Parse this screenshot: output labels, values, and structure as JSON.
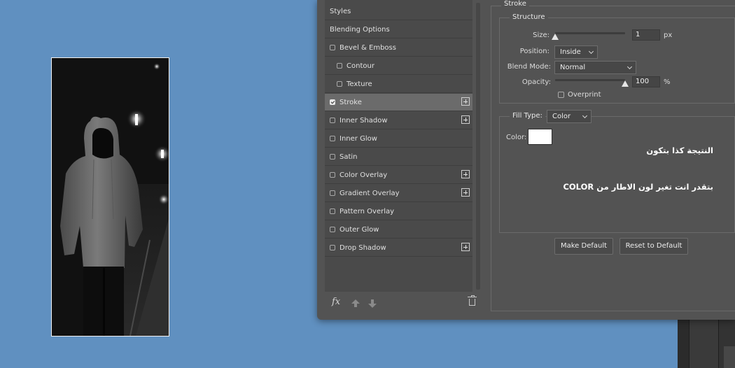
{
  "styles_list": [
    {
      "label": "Styles",
      "has_checkbox": false,
      "checked": false,
      "sub": false,
      "has_plus": false,
      "selected": false
    },
    {
      "label": "Blending Options",
      "has_checkbox": false,
      "checked": false,
      "sub": false,
      "has_plus": false,
      "selected": false
    },
    {
      "label": "Bevel & Emboss",
      "has_checkbox": true,
      "checked": false,
      "sub": false,
      "has_plus": false,
      "selected": false
    },
    {
      "label": "Contour",
      "has_checkbox": true,
      "checked": false,
      "sub": true,
      "has_plus": false,
      "selected": false
    },
    {
      "label": "Texture",
      "has_checkbox": true,
      "checked": false,
      "sub": true,
      "has_plus": false,
      "selected": false
    },
    {
      "label": "Stroke",
      "has_checkbox": true,
      "checked": true,
      "sub": false,
      "has_plus": true,
      "selected": true
    },
    {
      "label": "Inner Shadow",
      "has_checkbox": true,
      "checked": false,
      "sub": false,
      "has_plus": true,
      "selected": false
    },
    {
      "label": "Inner Glow",
      "has_checkbox": true,
      "checked": false,
      "sub": false,
      "has_plus": false,
      "selected": false
    },
    {
      "label": "Satin",
      "has_checkbox": true,
      "checked": false,
      "sub": false,
      "has_plus": false,
      "selected": false
    },
    {
      "label": "Color Overlay",
      "has_checkbox": true,
      "checked": false,
      "sub": false,
      "has_plus": true,
      "selected": false
    },
    {
      "label": "Gradient Overlay",
      "has_checkbox": true,
      "checked": false,
      "sub": false,
      "has_plus": true,
      "selected": false
    },
    {
      "label": "Pattern Overlay",
      "has_checkbox": true,
      "checked": false,
      "sub": false,
      "has_plus": false,
      "selected": false
    },
    {
      "label": "Outer Glow",
      "has_checkbox": true,
      "checked": false,
      "sub": false,
      "has_plus": false,
      "selected": false
    },
    {
      "label": "Drop Shadow",
      "has_checkbox": true,
      "checked": false,
      "sub": false,
      "has_plus": true,
      "selected": false
    }
  ],
  "bottom_toolbar": {
    "fx_label": "fx",
    "icons": [
      "fx-icon",
      "move-up-icon",
      "move-down-icon",
      "trash-icon"
    ]
  },
  "stroke": {
    "section_title": "Stroke",
    "structure_title": "Structure",
    "size_label": "Size:",
    "size_value": "1",
    "size_unit": "px",
    "size_fraction": 0.0,
    "position_label": "Position:",
    "position_value": "Inside",
    "blend_mode_label": "Blend Mode:",
    "blend_mode_value": "Normal",
    "opacity_label": "Opacity:",
    "opacity_value": "100",
    "opacity_unit": "%",
    "opacity_fraction": 1.0,
    "overprint_label": "Overprint",
    "overprint_checked": false,
    "fill_type_label": "Fill Type:",
    "fill_type_value": "Color",
    "color_label": "Color:",
    "color_value": "#ffffff"
  },
  "annotations": {
    "line1": "النتيجة كذا بتكون",
    "line2": "بتقدر انت تغير لون الاطار من COLOR"
  },
  "buttons": {
    "make_default": "Make Default",
    "reset_default": "Reset to Default"
  },
  "colors": {
    "background": "#6090c0",
    "dialog": "#535353",
    "list": "#4a4a4a",
    "selected_row": "#6b6b6b",
    "stroke_color": "#ffffff"
  }
}
